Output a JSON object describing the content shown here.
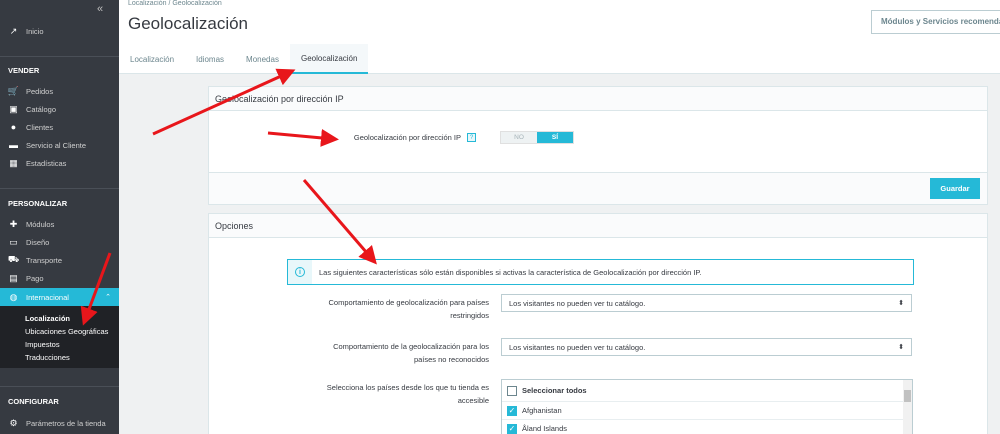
{
  "sidebar": {
    "collapse_icon": "«",
    "home": "Inicio",
    "sections": {
      "sell": "VENDER",
      "customize": "PERSONALIZAR",
      "configure": "CONFIGURAR"
    },
    "sell_items": [
      "Pedidos",
      "Catálogo",
      "Clientes",
      "Servicio al Cliente",
      "Estadísticas"
    ],
    "customize_items": [
      "Módulos",
      "Diseño",
      "Transporte",
      "Pago"
    ],
    "international": "Internacional",
    "international_sub": [
      "Localización",
      "Ubicaciones Geográficas",
      "Impuestos",
      "Traducciones"
    ],
    "configure_items": [
      "Parámetros de la tienda"
    ]
  },
  "header": {
    "breadcrumb": "Localización  /  Geolocalización",
    "title": "Geolocalización",
    "modules_button": "Módulos y Servicios recomendados",
    "tabs": [
      "Localización",
      "Idiomas",
      "Monedas",
      "Geolocalización"
    ]
  },
  "ip_panel": {
    "title": "Geolocalización por dirección IP",
    "field_label": "Geolocalización por dirección IP",
    "help": "?",
    "switch_off": "NO",
    "switch_on": "SÍ",
    "save_label": "Guardar"
  },
  "options_panel": {
    "title": "Opciones",
    "info_text": "Las siguientes características sólo están disponibles si activas la característica de Geolocalización por dirección IP.",
    "restricted_label_1": "Comportamiento de geolocalización para países",
    "restricted_label_2": "restringidos",
    "restricted_value": "Los visitantes no pueden ver tu catálogo.",
    "unknown_label_1": "Comportamiento de la geolocalización para los",
    "unknown_label_2": "países no reconocidos",
    "unknown_value": "Los visitantes no pueden ver tu catálogo.",
    "countries_label_1": "Selecciona los países desde los que tu tienda es",
    "countries_label_2": "accesible",
    "select_all": "Seleccionar todos",
    "countries": [
      "Afghanistan",
      "Åland Islands"
    ]
  },
  "colors": {
    "accent": "#25b9d7",
    "sidebar": "#363a41",
    "arrow": "#e8161b"
  }
}
